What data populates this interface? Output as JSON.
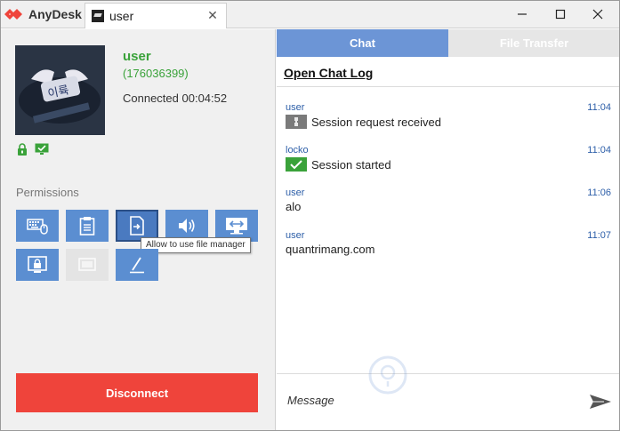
{
  "app": {
    "name": "AnyDesk",
    "brand_color": "#ef443b"
  },
  "tab": {
    "label": "user",
    "close_glyph": "✕"
  },
  "window_controls": {
    "minimize": "─",
    "maximize": "☐",
    "close": "✕"
  },
  "remote": {
    "name": "user",
    "id": "(176036399)",
    "connected_label": "Connected 00:04:52",
    "name_color": "#3aa23a"
  },
  "permissions": {
    "title": "Permissions",
    "tooltip": "Allow to use file manager",
    "button_color": "#5b8ed1",
    "items": [
      {
        "icon": "keyboard-mouse-icon"
      },
      {
        "icon": "clipboard-icon"
      },
      {
        "icon": "file-manager-icon"
      },
      {
        "icon": "speaker-icon"
      },
      {
        "icon": "screen-control-icon"
      },
      {
        "icon": "lock-screen-icon"
      },
      {
        "icon": "privacy-mode-icon"
      },
      {
        "icon": "whiteboard-pen-icon"
      }
    ]
  },
  "disconnect": {
    "label": "Disconnect"
  },
  "tabs": {
    "chat": "Chat",
    "file_transfer": "File Transfer"
  },
  "chat": {
    "open_log": "Open Chat Log",
    "messages": [
      {
        "sender": "user",
        "time": "11:04",
        "text": "Session request received",
        "icon": "session-request-icon"
      },
      {
        "sender": "locko",
        "time": "11:04",
        "text": "Session started",
        "icon": "session-started-icon"
      },
      {
        "sender": "user",
        "time": "11:06",
        "text": "alo",
        "icon": ""
      },
      {
        "sender": "user",
        "time": "11:07",
        "text": "quantrimang.com",
        "icon": ""
      }
    ],
    "input_placeholder": "Message",
    "send_icon": "send-icon"
  }
}
